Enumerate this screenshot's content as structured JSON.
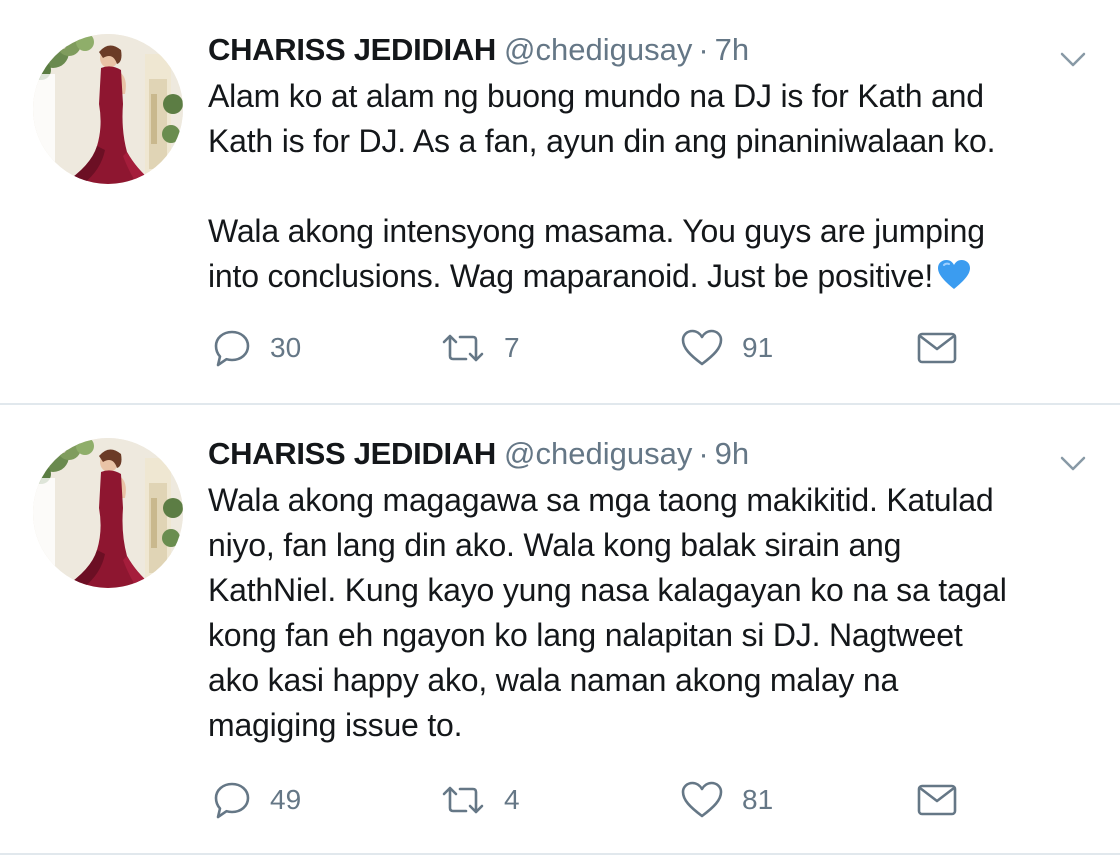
{
  "tweets": [
    {
      "author_name": "CHARISS JEDIDIAH",
      "handle": "@chedigusay",
      "separator": "·",
      "time": "7h",
      "text": "Alam ko at alam ng buong mundo na DJ is for Kath and\nKath is for DJ. As a fan, ayun din ang pinaniniwalaan ko.\n\nWala akong intensyong masama. You guys are jumping\ninto conclusions. Wag maparanoid. Just be positive!",
      "emoji": "blue-heart-icon",
      "replies": "30",
      "retweets": "7",
      "likes": "91"
    },
    {
      "author_name": "CHARISS JEDIDIAH",
      "handle": "@chedigusay",
      "separator": "·",
      "time": "9h",
      "text": "Wala akong magagawa sa mga taong makikitid. Katulad\nniyo, fan lang din ako. Wala kong balak sirain ang\nKathNiel. Kung kayo yung nasa kalagayan ko na sa tagal\nkong fan eh ngayon ko lang nalapitan si DJ. Nagtweet\nako kasi happy ako, wala naman akong malay na\nmagiging issue to.",
      "replies": "49",
      "retweets": "4",
      "likes": "81"
    }
  ],
  "icons": {
    "reply": "reply-icon",
    "retweet": "retweet-icon",
    "like": "heart-icon",
    "dm": "envelope-icon",
    "caret": "chevron-down-icon"
  },
  "colors": {
    "text": "#14171a",
    "secondary": "#657786",
    "divider": "#e1e8ed",
    "emoji_heart": "#3b9cf0"
  }
}
